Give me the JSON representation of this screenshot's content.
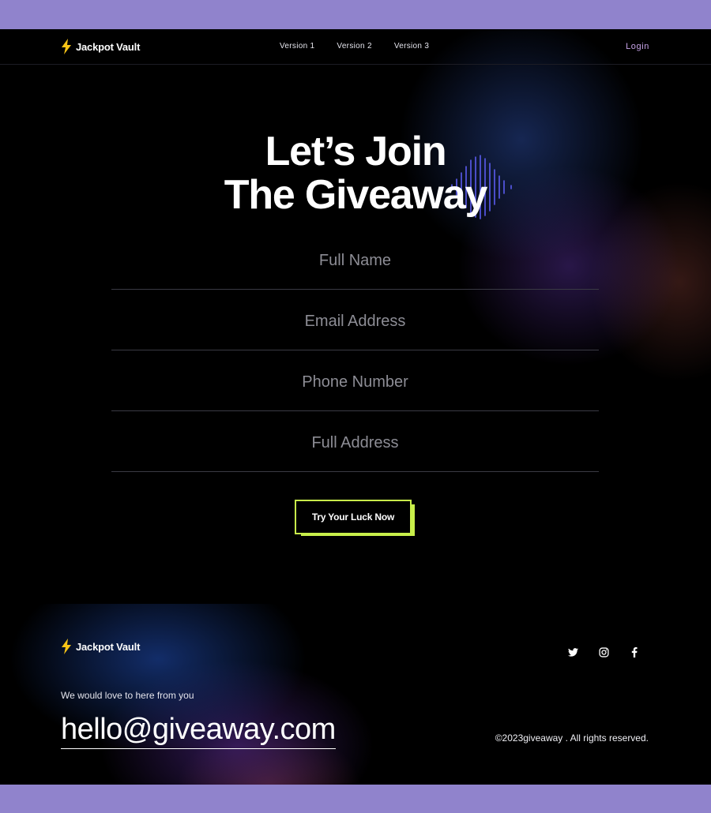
{
  "brand": {
    "name": "Jackpot Vault",
    "icon": "lightning-bolt-icon",
    "accent": "#f7c416"
  },
  "nav": {
    "links": [
      "Version 1",
      "Version 2",
      "Version 3"
    ],
    "login": "Login"
  },
  "hero": {
    "title_line1": "Let’s Join",
    "title_line2": "The Giveaway"
  },
  "form": {
    "fields": [
      {
        "placeholder": "Full Name"
      },
      {
        "placeholder": "Email Address"
      },
      {
        "placeholder": "Phone Number"
      },
      {
        "placeholder": "Full Address"
      }
    ],
    "submit_label": "Try Your Luck Now",
    "accent": "#c8ef4a"
  },
  "footer": {
    "tagline": "We would love to here from you",
    "email": "hello@giveaway.com",
    "copyright": "©2023giveaway . All rights reserved.",
    "socials": [
      "twitter-icon",
      "instagram-icon",
      "facebook-icon"
    ]
  },
  "colors": {
    "page_bg": "#000000",
    "frame": "#9083cc",
    "login": "#c7a3e8",
    "wave": "#5b5cf0"
  }
}
